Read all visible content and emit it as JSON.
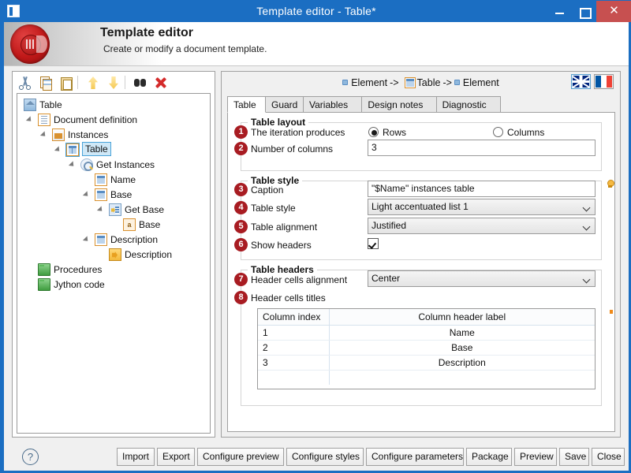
{
  "window": {
    "title": "Template editor - Table*",
    "app_icon": "document-icon",
    "minimize_label": "–",
    "maximize_label": "□",
    "close_label": "✕"
  },
  "banner": {
    "logo": "red-disc-logo",
    "title": "Template editor",
    "subtitle": "Create or modify a document template."
  },
  "tree_toolbar": {
    "items": [
      {
        "name": "cut-icon",
        "tooltip": "Cut"
      },
      {
        "name": "copy-icon",
        "tooltip": "Copy"
      },
      {
        "name": "paste-icon",
        "tooltip": "Paste"
      },
      {
        "name": "move-up-icon",
        "tooltip": "Move up"
      },
      {
        "name": "move-down-icon",
        "tooltip": "Move down"
      },
      {
        "name": "find-icon",
        "tooltip": "Find"
      },
      {
        "name": "delete-icon",
        "tooltip": "Delete"
      }
    ]
  },
  "tree": {
    "nodes": [
      {
        "label": "Table",
        "depth": 0,
        "icon": "house-icon",
        "expanded": true,
        "selected": false
      },
      {
        "label": "Document definition",
        "depth": 1,
        "icon": "document-icon",
        "expanded": true,
        "selected": false
      },
      {
        "label": "Instances",
        "depth": 2,
        "icon": "instances-icon",
        "expanded": true,
        "selected": false
      },
      {
        "label": "Table",
        "depth": 3,
        "icon": "table-icon",
        "expanded": true,
        "selected": true
      },
      {
        "label": "Get Instances",
        "depth": 4,
        "icon": "magnifier-icon",
        "expanded": true,
        "selected": false
      },
      {
        "label": "Name",
        "depth": 5,
        "icon": "field-icon",
        "expanded": false,
        "selected": false
      },
      {
        "label": "Base",
        "depth": 5,
        "icon": "field-icon",
        "expanded": true,
        "selected": false
      },
      {
        "label": "Get Base",
        "depth": 6,
        "icon": "get-base-icon",
        "expanded": true,
        "selected": false
      },
      {
        "label": "Base",
        "depth": 7,
        "icon": "attribute-icon",
        "expanded": false,
        "selected": false
      },
      {
        "label": "Description",
        "depth": 5,
        "icon": "field-icon",
        "expanded": true,
        "selected": false
      },
      {
        "label": "Description",
        "depth": 6,
        "icon": "description-icon",
        "expanded": false,
        "selected": false
      },
      {
        "label": "Procedures",
        "depth": 1,
        "icon": "folder-icon",
        "expanded": false,
        "selected": false
      },
      {
        "label": "Jython code",
        "depth": 1,
        "icon": "folder-icon",
        "expanded": false,
        "selected": false
      }
    ]
  },
  "breadcrumb": {
    "part1": "Element",
    "arrow1": "->",
    "part2": "Table",
    "arrow2": "->",
    "part3": "Element"
  },
  "language": {
    "english_label": "English",
    "french_label": "French",
    "selected": "English"
  },
  "tabs": [
    {
      "label": "Table",
      "active": true
    },
    {
      "label": "Guard",
      "active": false
    },
    {
      "label": "Variables",
      "active": false
    },
    {
      "label": "Design notes",
      "active": false
    },
    {
      "label": "Diagnostic",
      "active": false
    }
  ],
  "groups": {
    "table_layout": {
      "title": "Table layout",
      "iteration_produces": {
        "badge": "1",
        "label": "The iteration produces",
        "options": [
          {
            "label": "Rows",
            "selected": true
          },
          {
            "label": "Columns",
            "selected": false
          }
        ]
      },
      "number_of_columns": {
        "badge": "2",
        "label": "Number of columns",
        "value": "3"
      }
    },
    "table_style": {
      "title": "Table style",
      "caption": {
        "badge": "3",
        "label": "Caption",
        "value": "\"$Name\" instances table",
        "hint_icon": "bulb-icon"
      },
      "table_style": {
        "badge": "4",
        "label": "Table style",
        "value": "Light accentuated list 1"
      },
      "table_alignment": {
        "badge": "5",
        "label": "Table alignment",
        "value": "Justified"
      },
      "show_headers": {
        "badge": "6",
        "label": "Show headers",
        "checked": true
      }
    },
    "table_headers": {
      "title": "Table headers",
      "header_cells_alignment": {
        "badge": "7",
        "label": "Header cells alignment",
        "value": "Center"
      },
      "header_cells_titles": {
        "badge": "8",
        "label": "Header cells titles",
        "columns": [
          "Column index",
          "Column header label"
        ],
        "rows": [
          {
            "index": "1",
            "header_label": "Name"
          },
          {
            "index": "2",
            "header_label": "Base"
          },
          {
            "index": "3",
            "header_label": "Description"
          },
          {
            "index": "",
            "header_label": ""
          }
        ]
      }
    }
  },
  "footer": {
    "help_icon": "question-mark-icon",
    "buttons": [
      {
        "label": "Import"
      },
      {
        "label": "Export"
      },
      {
        "label": "Configure preview"
      },
      {
        "label": "Configure styles"
      },
      {
        "label": "Configure parameters"
      },
      {
        "label": "Package"
      },
      {
        "label": "Preview"
      },
      {
        "label": "Save"
      },
      {
        "label": "Close"
      }
    ]
  },
  "colors": {
    "window_chrome": "#1b6ec2",
    "close_button": "#c75050",
    "badge": "#a81c22",
    "selection": "#cfe8f7",
    "scroll_marker": "#f08a1a"
  }
}
